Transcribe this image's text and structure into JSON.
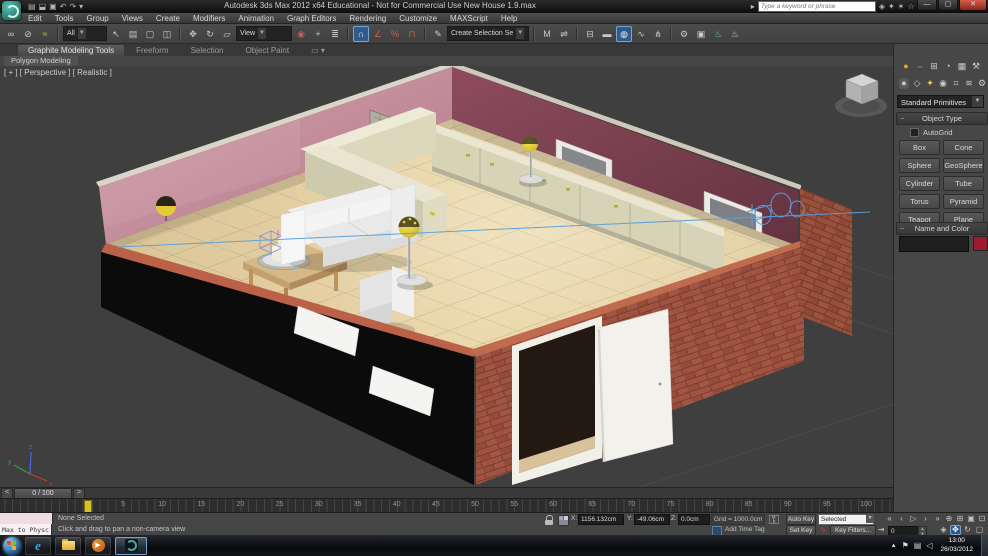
{
  "window": {
    "title": "Autodesk 3ds Max 2012 x64   Educational - Not for Commercial Use    New House 1.9.max",
    "search_placeholder": "Type a keyword or phrase",
    "minimize": "—",
    "maximize": "▢",
    "close": "✕"
  },
  "menu": {
    "items": [
      "Edit",
      "Tools",
      "Group",
      "Views",
      "Create",
      "Modifiers",
      "Animation",
      "Graph Editors",
      "Rendering",
      "Customize",
      "MAXScript",
      "Help"
    ]
  },
  "toolbar": {
    "selection_filter": "All",
    "reference_coordinate": "View",
    "named_selection": "Create Selection Se"
  },
  "ribbon": {
    "tabs": [
      "Graphite Modeling Tools",
      "Freeform",
      "Selection",
      "Object Paint"
    ],
    "active_tab": "Graphite Modeling Tools",
    "sub_tab": "Polygon Modeling"
  },
  "viewport": {
    "label": "[ + ] [ Perspective ] [ Realistic ]"
  },
  "command_panel": {
    "category_dropdown": "Standard Primitives",
    "object_type": {
      "title": "Object Type",
      "autogrid_label": "AutoGrid",
      "buttons": [
        "Box",
        "Cone",
        "Sphere",
        "GeoSphere",
        "Cylinder",
        "Tube",
        "Torus",
        "Pyramid",
        "Teapot",
        "Plane"
      ]
    },
    "name_and_color": {
      "title": "Name and Color",
      "name_value": "",
      "swatch_color": "#9c1b2e"
    }
  },
  "timeline": {
    "slider_label": "0 / 100",
    "prev": "<",
    "next": ">",
    "ticks": [
      5,
      10,
      15,
      20,
      25,
      30,
      35,
      40,
      45,
      50,
      55,
      60,
      65,
      70,
      75,
      80,
      85,
      90,
      95,
      100
    ]
  },
  "status_bar": {
    "listener_input": "Max to Physc",
    "status_line": "None Selected",
    "prompt_line": "Click and drag to pan a non-camera view",
    "x_label": "X:",
    "x_value": "1156.132cm",
    "y_label": "Y:",
    "y_value": "-49.06cm",
    "z_label": "Z:",
    "z_value": "0.0cm",
    "grid_label": "Grid = 1000.0cm",
    "add_time_tag": "Add Time Tag",
    "auto_key": "Auto Key",
    "set_key": "Set Key",
    "selected_dropdown": "Selected",
    "key_filters": "Key Filters...",
    "frame_value": "0"
  },
  "taskbar": {
    "time": "13:00",
    "date": "26/03/2012"
  },
  "colors": {
    "selection_blue": "#5b9bd5",
    "swatch_red": "#9c1b2e",
    "lamp_yellow": "#e8d23c",
    "viewport_bg": "#3f3f3f"
  }
}
